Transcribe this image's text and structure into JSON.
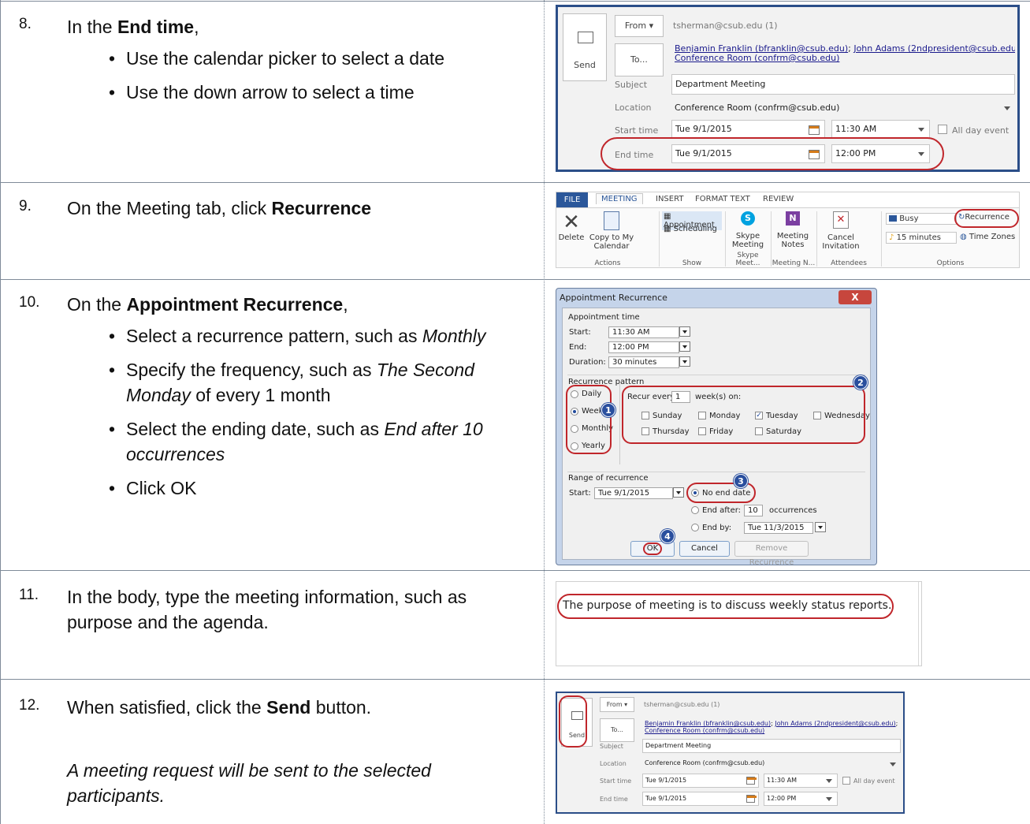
{
  "steps": [
    {
      "number": "8.",
      "lead": "In the ",
      "bold": "End time",
      "tail": ",",
      "bullets": [
        "Use the calendar picker to select a date",
        "Use the down arrow to select a time"
      ]
    },
    {
      "number": "9.",
      "lead": "On the Meeting tab, click ",
      "bold": "Recurrence"
    },
    {
      "number": "10.",
      "lead": "On the ",
      "bold": "Appointment Recurrence",
      "tail": ",",
      "bullets": [
        {
          "text": "Select a recurrence pattern, such as ",
          "italic": "Monthly"
        },
        {
          "text": "Specify the frequency, such as ",
          "italic": "The Second Monday",
          "after": " of every 1 month"
        },
        {
          "text": "Select the ending date, such as ",
          "italic": "End after 10 occurrences"
        },
        {
          "text": "Click OK"
        }
      ]
    },
    {
      "number": "11.",
      "lead": "In the body, type the meeting information, such as purpose and the agenda."
    },
    {
      "number": "12.",
      "lead": "When satisfied, click the ",
      "bold": "Send",
      "tail": " button.",
      "note": "A meeting request will be sent to the selected participants."
    }
  ],
  "compose": {
    "send_label": "Send",
    "from_label": "From",
    "from_value": "tsherman@csub.edu (1)",
    "to_label": "To...",
    "to_line1_a": "Benjamin Franklin (bfranklin@csub.edu)",
    "to_line1_sep": "; ",
    "to_line1_b": "John Adams (2ndpresident@csub.edu)",
    "to_line1_end": ";",
    "to_line2": "Conference Room (confrm@csub.edu)",
    "subject_label": "Subject",
    "subject_value": "Department Meeting",
    "location_label": "Location",
    "location_value": "Conference Room (confrm@csub.edu)",
    "start_label": "Start time",
    "start_date": "Tue 9/1/2015",
    "start_time": "11:30 AM",
    "allday_label": "All day event",
    "end_label": "End time",
    "end_date": "Tue 9/1/2015",
    "end_time": "12:00 PM"
  },
  "ribbon": {
    "file": "FILE",
    "tabs": [
      "MEETING",
      "INSERT",
      "FORMAT TEXT",
      "REVIEW"
    ],
    "delete": "Delete",
    "copy_line1": "Copy to My",
    "copy_line2": "Calendar",
    "appointment": "Appointment",
    "scheduling": "Scheduling",
    "skype_line1": "Skype",
    "skype_line2": "Meeting",
    "notes_line1": "Meeting",
    "notes_line2": "Notes",
    "cancel_line1": "Cancel",
    "cancel_line2": "Invitation",
    "busy": "Busy",
    "reminder": "15 minutes",
    "recurrence": "Recurrence",
    "timezones": "Time Zones",
    "groups": [
      "Actions",
      "Show",
      "Skype Meet...",
      "Meeting N...",
      "Attendees",
      "Options"
    ]
  },
  "dialog": {
    "title": "Appointment Recurrence",
    "close": "X",
    "appointment_time": "Appointment time",
    "start_label": "Start:",
    "start_value": "11:30 AM",
    "end_label": "End:",
    "end_value": "12:00 PM",
    "duration_label": "Duration:",
    "duration_value": "30 minutes",
    "pattern_label": "Recurrence pattern",
    "patterns": [
      "Daily",
      "Weekly",
      "Monthly",
      "Yearly"
    ],
    "recur_every": "Recur every",
    "recur_value": "1",
    "weeks_on": "week(s) on:",
    "days": [
      "Sunday",
      "Monday",
      "Tuesday",
      "Wednesday",
      "Thursday",
      "Friday",
      "Saturday"
    ],
    "range_label": "Range of recurrence",
    "range_start_label": "Start:",
    "range_start_value": "Tue 9/1/2015",
    "no_end": "No end date",
    "end_after": "End after:",
    "end_after_value": "10",
    "occurrences": "occurrences",
    "end_by": "End by:",
    "end_by_value": "Tue 11/3/2015",
    "ok": "OK",
    "cancel": "Cancel",
    "remove": "Remove Recurrence",
    "badges": [
      "1",
      "2",
      "3",
      "4"
    ]
  },
  "body_text": "The purpose of meeting is to discuss weekly status reports."
}
